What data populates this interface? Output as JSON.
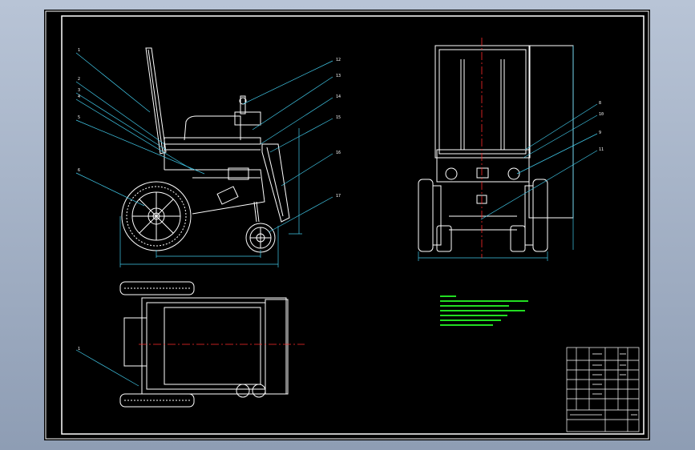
{
  "drawing": {
    "colors": {
      "background": "#8e9db4",
      "sheet": "#000000",
      "outline": "#ffffff",
      "leader": "#40c8e8",
      "centerline": "#ff2a2a",
      "notes": "#22dd22"
    },
    "balloons_side_left": [
      "1",
      "2",
      "3",
      "4",
      "5",
      "6"
    ],
    "balloons_side_right": [
      "12",
      "13",
      "14",
      "15",
      "16",
      "17"
    ],
    "balloons_front": [
      "8",
      "10",
      "9",
      "11"
    ],
    "balloons_top": [
      "1"
    ]
  }
}
